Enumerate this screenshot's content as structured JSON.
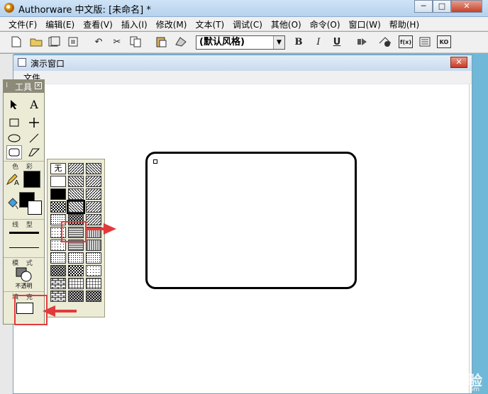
{
  "window": {
    "title": "Authorware 中文版: [未命名] *",
    "minimize": "─",
    "maximize": "□",
    "close": "✕"
  },
  "menubar": [
    "文件(F)",
    "编辑(E)",
    "查看(V)",
    "插入(I)",
    "修改(M)",
    "文本(T)",
    "调试(C)",
    "其他(O)",
    "命令(O)",
    "窗口(W)",
    "帮助(H)"
  ],
  "toolbar": {
    "style_value": "(默认风格)",
    "bold": "B",
    "italic": "I",
    "underline": "U",
    "fx": "f(x)",
    "ko": "KO"
  },
  "presentation": {
    "title": "演示窗口",
    "menu_file": "文件",
    "close": "✕"
  },
  "tools": {
    "title": "工具",
    "close": "✕",
    "section_color": "色 彩",
    "section_line": "线 型",
    "section_mode": "模 式",
    "mode_value": "不透明",
    "section_fill": "填 充"
  },
  "patterns": {
    "none_label": "无",
    "count": 32,
    "selected_index": 10
  },
  "watermark": {
    "brand": "Baidu 经验",
    "url": "jingyan.baidu.com"
  },
  "colors": {
    "annotation": "#e23a3a",
    "palette_bg": "#ecebd6"
  }
}
